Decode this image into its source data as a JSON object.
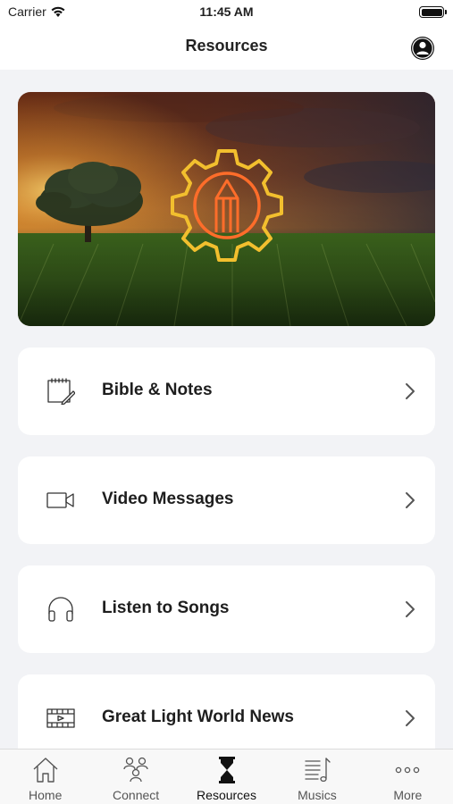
{
  "status_bar": {
    "carrier": "Carrier",
    "time": "11:45 AM"
  },
  "nav": {
    "title": "Resources"
  },
  "hero": {
    "alt": "Resources banner"
  },
  "menu": [
    {
      "label": "Bible & Notes",
      "icon": "notebook-edit-icon"
    },
    {
      "label": "Video Messages",
      "icon": "video-camera-icon"
    },
    {
      "label": "Listen to Songs",
      "icon": "headphones-icon"
    },
    {
      "label": "Great Light World News",
      "icon": "film-news-icon"
    }
  ],
  "tabs": [
    {
      "label": "Home",
      "icon": "home-icon",
      "active": false
    },
    {
      "label": "Connect",
      "icon": "people-icon",
      "active": false
    },
    {
      "label": "Resources",
      "icon": "hourglass-icon",
      "active": true
    },
    {
      "label": "Musics",
      "icon": "music-list-icon",
      "active": false
    },
    {
      "label": "More",
      "icon": "more-dots-icon",
      "active": false
    }
  ],
  "colors": {
    "accent": "#f0b82e",
    "orange": "#ff6d2a",
    "background": "#f2f3f6"
  }
}
